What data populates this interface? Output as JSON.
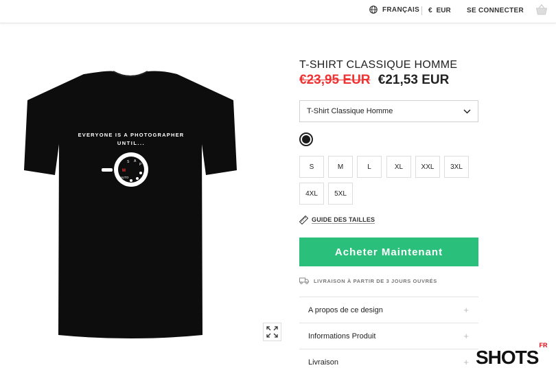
{
  "header": {
    "language": "FRANÇAIS",
    "currency_symbol": "€",
    "currency_code": "EUR",
    "login": "SE CONNECTER",
    "icons": [
      "globe-icon",
      "basket-icon"
    ]
  },
  "product": {
    "title": "T-SHIRT CLASSIQUE HOMME",
    "old_price": "€23,95 EUR",
    "new_price": "€21,53 EUR",
    "print_text_line1": "EVERYONE IS A PHOTOGRAPHER",
    "print_text_line2": "UNTIL...",
    "dial_labels": [
      "M",
      "AUTO",
      "S",
      "A",
      "P"
    ],
    "variant_select": "T-Shirt Classique Homme",
    "color_selected": "#1a1a1a",
    "sizes": [
      "S",
      "M",
      "L",
      "XL",
      "XXL",
      "3XL",
      "4XL",
      "5XL"
    ],
    "size_guide": "GUIDE DES TAILLES",
    "buy_label": "Acheter Maintenant",
    "delivery_text": "LIVRAISON À PARTIR DE 3 JOURS OUVRÉS",
    "accordion": [
      "A propos de ce design",
      "Informations Produit",
      "Livraison"
    ],
    "accordion_icon": "+"
  },
  "watermark": {
    "text": "SHOTS",
    "sup": "FR"
  },
  "colors": {
    "accent": "#2abf7a",
    "sale": "#e33333"
  }
}
